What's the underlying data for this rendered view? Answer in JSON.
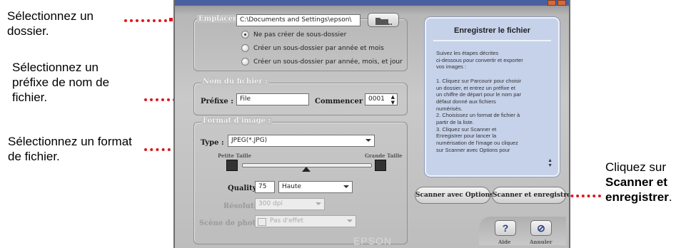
{
  "callouts": {
    "folder": "Sélectionnez un dossier.",
    "prefix": "Sélectionnez un préfixe de nom de fichier.",
    "format": "Sélectionnez un format de fichier.",
    "scan_pre": "Cliquez sur",
    "scan_bold1": "Scanner et",
    "scan_bold2": "enregistrer",
    "scan_post": "."
  },
  "location": {
    "legend": "Emplacement",
    "path": "C:\\Documents and Settings\\epson\\",
    "radios": [
      {
        "label": "Ne pas créer de sous-dossier",
        "selected": true
      },
      {
        "label": "Créer un sous-dossier par année et mois",
        "selected": false
      },
      {
        "label": "Créer un sous-dossier par année, mois, et jour",
        "selected": false
      }
    ]
  },
  "filename": {
    "legend": "Nom du fichier :",
    "prefix_label": "Préfixe :",
    "prefix_value": "File",
    "start_label": "Commencer à :",
    "start_value": "0001"
  },
  "format": {
    "legend": "Format d'image :",
    "type_label": "Type :",
    "type_value": "JPEG(*.JPG)",
    "small_label": "Petite Taille",
    "large_label": "Grande Taille",
    "slider_level": 0.5,
    "quality_label": "Quality:",
    "quality_value": "75",
    "quality_level": "Haute",
    "resolution_label": "Résolution:",
    "resolution_value": "300 dpi",
    "scene_label": "Scène de photo:",
    "scene_value": "Pas d'effet"
  },
  "info": {
    "title": "Enregistrer le fichier",
    "body": "Suivez les étapes décrites\nci-dessous pour convertir et exporter\nvos images :\n\n1. Cliquez sur Parcourir pour choisir\nun dossier, et entrez un préfixe et\nun chiffre de départ pour le nom par\ndéfaut donné aux fichiers\nnumérisés.\n2. Choisissez un format de fichier à\npartir de la liste.\n3. Cliquez sur Scanner et\nEnregistrer pour lancer la\nnumérisation de l'image ou cliquez\nsur Scanner avec Options pour"
  },
  "buttons": {
    "scan_options": "Scanner avec Options",
    "scan_save": "Scanner et enregistrer",
    "help_symbol": "?",
    "help_label": "Aide",
    "cancel_symbol": "⊘",
    "cancel_label": "Annuler"
  },
  "brand": "EPSON",
  "colors": {
    "callout_dots": "#e0151b",
    "info_panel": "#c6d2ea"
  }
}
